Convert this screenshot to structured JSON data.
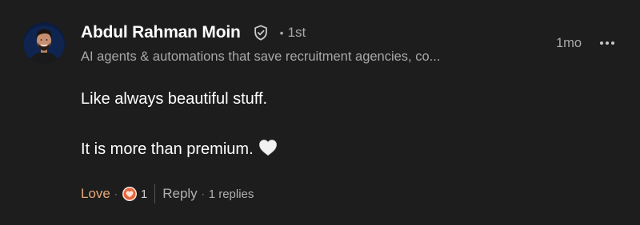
{
  "comment": {
    "author": {
      "name": "Abdul Rahman Moin",
      "degree": "1st",
      "degree_separator": "•",
      "headline": "AI agents & automations that save recruitment agencies, co..."
    },
    "timestamp": "1mo",
    "body": {
      "line1": "Like always beautiful stuff.",
      "line2": "It is more than premium."
    },
    "actions": {
      "love_label": "Love",
      "separator": "·",
      "reaction_count": "1",
      "reply_label": "Reply",
      "replies_text": "1 replies"
    }
  },
  "icons": {
    "verified": "shield-check-icon",
    "more": "more-horizontal-icon",
    "heart_emoji": "white-heart-emoji",
    "reaction": "love-reaction-icon"
  },
  "colors": {
    "background": "#1d1d1d",
    "primary_text": "#ffffff",
    "secondary_text": "#a8a8a8",
    "love_accent": "#e8a87c",
    "reaction_badge": "#e8643c"
  }
}
